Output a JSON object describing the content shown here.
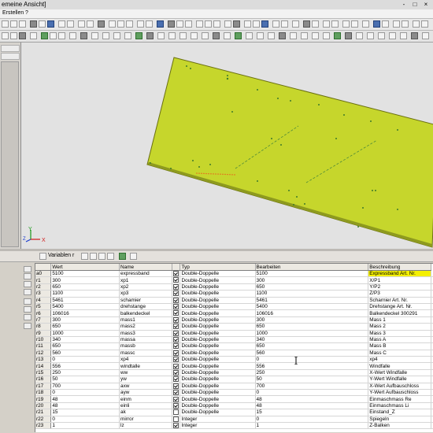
{
  "window": {
    "title": "emeine Ansicht]",
    "controls": [
      "-",
      "□",
      "×"
    ]
  },
  "menu": {
    "items": [
      "Erstellen",
      "?"
    ]
  },
  "var_panel": {
    "title": "Variablen r"
  },
  "axes": {
    "x": "X",
    "y": "Y",
    "z": "Z"
  },
  "table": {
    "columns": [
      "Wert",
      "Name",
      "",
      "Typ",
      "Bearbeiten",
      "Beschreibung"
    ],
    "rows": [
      {
        "id": "a0",
        "wert": "5100",
        "name": "expressband",
        "checked": true,
        "typ": "Double-Doppelle",
        "bearb": "5100",
        "beschr": "Expressband Art. Nr.",
        "hl": true
      },
      {
        "id": "r1",
        "wert": "300",
        "name": "xp1",
        "checked": true,
        "typ": "Double-Doppelle",
        "bearb": "300",
        "beschr": "X/P1",
        "hl": false
      },
      {
        "id": "r2",
        "wert": "650",
        "name": "xp2",
        "checked": true,
        "typ": "Double-Doppelle",
        "bearb": "650",
        "beschr": "Y/P2",
        "hl": false
      },
      {
        "id": "r3",
        "wert": "1100",
        "name": "xp3",
        "checked": true,
        "typ": "Double-Doppelle",
        "bearb": "1100",
        "beschr": "Z/P3",
        "hl": false
      },
      {
        "id": "r4",
        "wert": "5461",
        "name": "schamier",
        "checked": true,
        "typ": "Double-Doppelle",
        "bearb": "5461",
        "beschr": "Scharnier Art. Nr.",
        "hl": false
      },
      {
        "id": "r5",
        "wert": "5400",
        "name": "drehstange",
        "checked": true,
        "typ": "Double-Doppelle",
        "bearb": "5400",
        "beschr": "Drehstange Art. Nr.",
        "hl": false
      },
      {
        "id": "r6",
        "wert": "106016",
        "name": "balkendeckel",
        "checked": true,
        "typ": "Double-Doppelle",
        "bearb": "106016",
        "beschr": "Balkendeckel 300291",
        "hl": false
      },
      {
        "id": "r7",
        "wert": "300",
        "name": "mass1",
        "checked": true,
        "typ": "Double-Doppelle",
        "bearb": "300",
        "beschr": "Mass 1",
        "hl": false
      },
      {
        "id": "r8",
        "wert": "650",
        "name": "mass2",
        "checked": true,
        "typ": "Double-Doppelle",
        "bearb": "650",
        "beschr": "Mass 2",
        "hl": false
      },
      {
        "id": "r9",
        "wert": "1000",
        "name": "mass3",
        "checked": true,
        "typ": "Double-Doppelle",
        "bearb": "1000",
        "beschr": "Mass 3",
        "hl": false
      },
      {
        "id": "r10",
        "wert": "340",
        "name": "massa",
        "checked": true,
        "typ": "Double-Doppelle",
        "bearb": "340",
        "beschr": "Mass A",
        "hl": false
      },
      {
        "id": "r11",
        "wert": "650",
        "name": "massb",
        "checked": true,
        "typ": "Double-Doppelle",
        "bearb": "650",
        "beschr": "Mass B",
        "hl": false
      },
      {
        "id": "r12",
        "wert": "560",
        "name": "massc",
        "checked": true,
        "typ": "Double-Doppelle",
        "bearb": "560",
        "beschr": "Mass C",
        "hl": false
      },
      {
        "id": "r13",
        "wert": "0",
        "name": "xp4",
        "checked": true,
        "typ": "Double-Doppelle",
        "bearb": "0",
        "beschr": "xp4",
        "hl": false
      },
      {
        "id": "r14",
        "wert": "556",
        "name": "windtalle",
        "checked": true,
        "typ": "Double-Doppelle",
        "bearb": "556",
        "beschr": "Windfalle",
        "hl": false
      },
      {
        "id": "r15",
        "wert": "250",
        "name": "ww",
        "checked": true,
        "typ": "Double-Doppelle",
        "bearb": "250",
        "beschr": "X-Wert Windfalle",
        "hl": false
      },
      {
        "id": "r16",
        "wert": "50",
        "name": "yw",
        "checked": true,
        "typ": "Double-Doppelle",
        "bearb": "50",
        "beschr": "Y-Wert Windfalle",
        "hl": false
      },
      {
        "id": "r17",
        "wert": "700",
        "name": "axw",
        "checked": true,
        "typ": "Double-Doppelle",
        "bearb": "700",
        "beschr": "X-Wert Aufbauschloss",
        "hl": false
      },
      {
        "id": "r18",
        "wert": "0",
        "name": "ayw",
        "checked": true,
        "typ": "Double-Doppelle",
        "bearb": "0",
        "beschr": "Y-Wert Aufbauschloss",
        "hl": false
      },
      {
        "id": "r19",
        "wert": "48",
        "name": "einm",
        "checked": true,
        "typ": "Double-Doppelle",
        "bearb": "48",
        "beschr": "Einmaschmass Re",
        "hl": false
      },
      {
        "id": "r20",
        "wert": "48",
        "name": "einli",
        "checked": true,
        "typ": "Double-Doppelle",
        "bearb": "48",
        "beschr": "Einmaschmass Li",
        "hl": false
      },
      {
        "id": "r21",
        "wert": "15",
        "name": "ak",
        "checked": false,
        "typ": "Double-Doppelle",
        "bearb": "15",
        "beschr": "Einstand_Z",
        "hl": false
      },
      {
        "id": "r22",
        "wert": "0",
        "name": "mirror",
        "checked": false,
        "typ": "Integer",
        "bearb": "0",
        "beschr": "Spiegeln",
        "hl": false
      },
      {
        "id": "r23",
        "wert": "1",
        "name": "lz",
        "checked": true,
        "typ": "Integer",
        "bearb": "1",
        "beschr": "Z-Balken",
        "hl": false
      }
    ]
  }
}
